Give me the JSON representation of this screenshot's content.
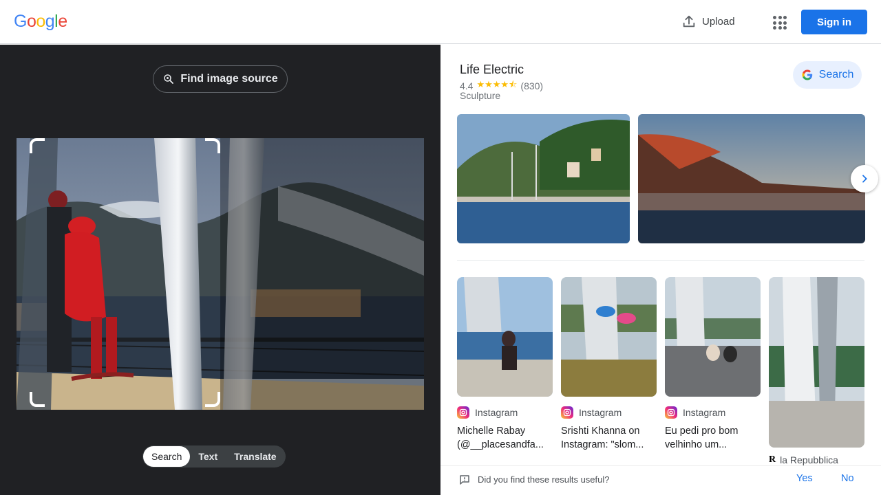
{
  "header": {
    "logo": [
      "G",
      "o",
      "o",
      "g",
      "l",
      "e"
    ],
    "upload_label": "Upload",
    "signin_label": "Sign in"
  },
  "left": {
    "find_source_label": "Find image source",
    "modes": [
      "Search",
      "Text",
      "Translate"
    ],
    "active_mode": "Search"
  },
  "knowledge_panel": {
    "title": "Life Electric",
    "rating": "4.4",
    "stars": "★★★★⯪",
    "review_count": "(830)",
    "category": "Sculpture",
    "search_label": "Search"
  },
  "results": [
    {
      "source": "Instagram",
      "title": "Michelle Rabay (@__placesandfa..."
    },
    {
      "source": "Instagram",
      "title": "Srishti Khanna on Instagram: \"slom..."
    },
    {
      "source": "Instagram",
      "title": "Eu pedi pro bom velhinho um..."
    },
    {
      "source": "la Repubblica",
      "title": ""
    }
  ],
  "feedback": {
    "question": "Did you find these results useful?",
    "yes": "Yes",
    "no": "No"
  },
  "colors": {
    "google_blue": "#4285F4",
    "google_red": "#EA4335",
    "google_yellow": "#FBBC05",
    "google_green": "#34A853",
    "accent": "#1a73e8",
    "dark_bg": "#202124"
  }
}
